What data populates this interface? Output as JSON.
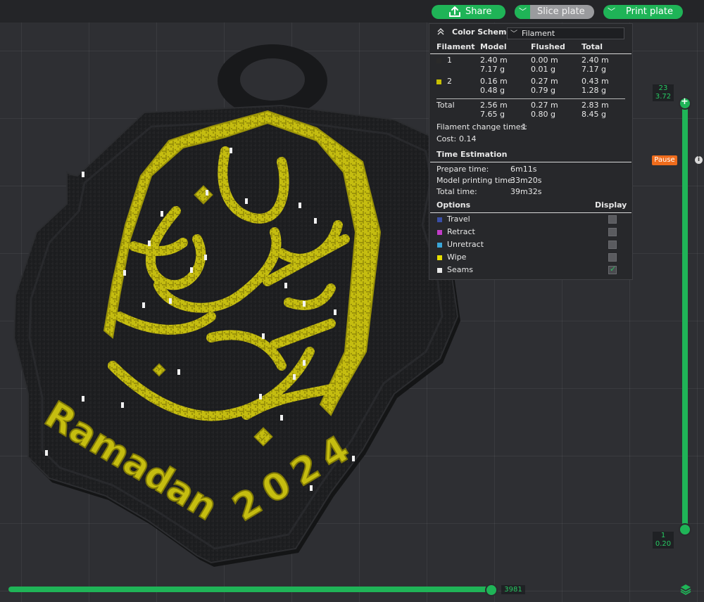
{
  "toolbar": {
    "share_label": "Share",
    "slice_label": "Slice plate",
    "print_label": "Print plate"
  },
  "model": {
    "text_word": "Ramadan",
    "text_year": "2024",
    "colors": {
      "body": "#1a1b1d",
      "accent": "#c5bd10",
      "seams": "#ffffff"
    }
  },
  "legend": {
    "title": "Color Scheme",
    "scheme_value": "Filament",
    "columns": [
      "Filament",
      "Model",
      "Flushed",
      "Total"
    ],
    "filaments": [
      {
        "id": "1",
        "color": "#2a2a2a",
        "model_len": "2.40 m",
        "model_wt": "7.17 g",
        "flushed_len": "0.00 m",
        "flushed_wt": "0.01 g",
        "total_len": "2.40 m",
        "total_wt": "7.17 g"
      },
      {
        "id": "2",
        "color": "#c8c000",
        "model_len": "0.16 m",
        "model_wt": "0.48 g",
        "flushed_len": "0.27 m",
        "flushed_wt": "0.79 g",
        "total_len": "0.43 m",
        "total_wt": "1.28 g"
      }
    ],
    "total": {
      "label": "Total",
      "model_len": "2.56 m",
      "model_wt": "7.65 g",
      "flushed_len": "0.27 m",
      "flushed_wt": "0.80 g",
      "total_len": "2.83 m",
      "total_wt": "8.45 g"
    },
    "change_label": "Filament change times:",
    "change_value": "1",
    "cost_label": "Cost:",
    "cost_value": "0.14",
    "time_title": "Time Estimation",
    "times": [
      {
        "label": "Prepare time:",
        "value": "6m11s"
      },
      {
        "label": "Model printing time:",
        "value": "33m20s"
      },
      {
        "label": "Total time:",
        "value": "39m32s"
      }
    ],
    "options_title": "Options",
    "display_title": "Display",
    "options": [
      {
        "label": "Travel",
        "color": "#3a4fa8",
        "checked": false
      },
      {
        "label": "Retract",
        "color": "#c23cc8",
        "checked": false
      },
      {
        "label": "Unretract",
        "color": "#3aa6d8",
        "checked": false
      },
      {
        "label": "Wipe",
        "color": "#e8e000",
        "checked": false
      },
      {
        "label": "Seams",
        "color": "#e8e8e8",
        "checked": true
      }
    ]
  },
  "layer_slider": {
    "top_layer": "23",
    "top_height": "3.72",
    "bottom_layer": "1",
    "bottom_height": "0.20",
    "pause_label": "Pause",
    "info_label": "i"
  },
  "move_slider": {
    "value": "3981"
  }
}
